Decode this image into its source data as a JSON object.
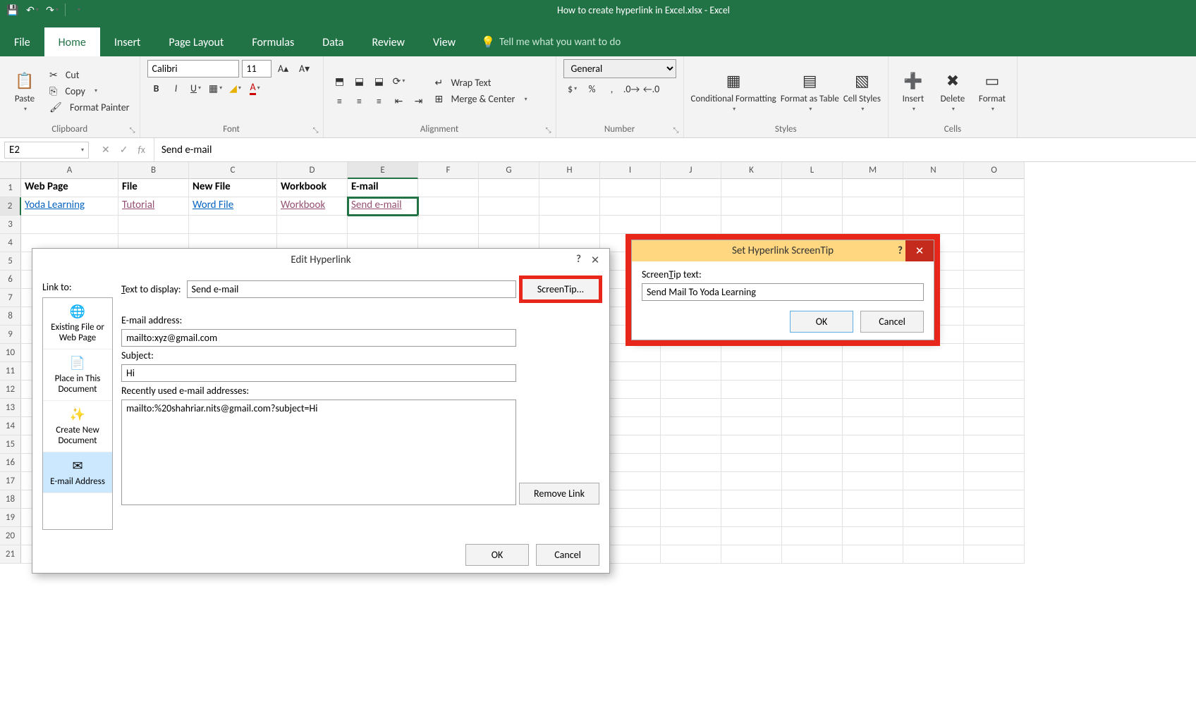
{
  "app": {
    "title": "How to create hyperlink in Excel.xlsx  -  Excel"
  },
  "tabs": [
    "File",
    "Home",
    "Insert",
    "Page Layout",
    "Formulas",
    "Data",
    "Review",
    "View"
  ],
  "active_tab": "Home",
  "tellme": "Tell me what you want to do",
  "ribbon": {
    "clipboard": {
      "label": "Clipboard",
      "paste": "Paste",
      "cut": "Cut",
      "copy": "Copy",
      "fp": "Format Painter"
    },
    "font": {
      "label": "Font",
      "name": "Calibri",
      "size": "11"
    },
    "alignment": {
      "label": "Alignment",
      "wrap": "Wrap Text",
      "merge": "Merge & Center"
    },
    "number": {
      "label": "Number",
      "format": "General"
    },
    "styles": {
      "label": "Styles",
      "cond": "Conditional Formatting",
      "tbl": "Format as Table",
      "cell": "Cell Styles"
    },
    "cells": {
      "label": "Cells",
      "insert": "Insert",
      "delete": "Delete",
      "format": "Format"
    }
  },
  "namebox": "E2",
  "formula": "Send e-mail",
  "columns": [
    "A",
    "B",
    "C",
    "D",
    "E",
    "F",
    "G",
    "H",
    "I",
    "J",
    "K",
    "L",
    "M",
    "N",
    "O"
  ],
  "rows": 21,
  "data": {
    "headers": [
      "Web Page",
      "File",
      "New File",
      "Workbook",
      "E-mail"
    ],
    "links": [
      {
        "text": "Yoda Learning",
        "visited": false
      },
      {
        "text": "Tutorial",
        "visited": true
      },
      {
        "text": "Word File",
        "visited": false
      },
      {
        "text": "Workbook",
        "visited": true
      },
      {
        "text": "Send e-mail",
        "visited": true
      }
    ]
  },
  "dialog": {
    "title": "Edit Hyperlink",
    "linkto_label": "Link to:",
    "linkto_items": [
      "Existing File or Web Page",
      "Place in This Document",
      "Create New Document",
      "E-mail Address"
    ],
    "linkto_selected": 3,
    "text_display_label": "Text to display:",
    "text_display": "Send e-mail",
    "screentip_btn": "ScreenTip...",
    "email_label": "E-mail address:",
    "email": "mailto:xyz@gmail.com",
    "subject_label": "Subject:",
    "subject": "Hi",
    "recent_label": "Recently used e-mail addresses:",
    "recent": "mailto:%20shahriar.nits@gmail.com?subject=Hi",
    "remove": "Remove Link",
    "ok": "OK",
    "cancel": "Cancel"
  },
  "tip": {
    "title": "Set Hyperlink ScreenTip",
    "label": "ScreenTip text:",
    "value": "Send Mail To Yoda Learning",
    "ok": "OK",
    "cancel": "Cancel"
  }
}
